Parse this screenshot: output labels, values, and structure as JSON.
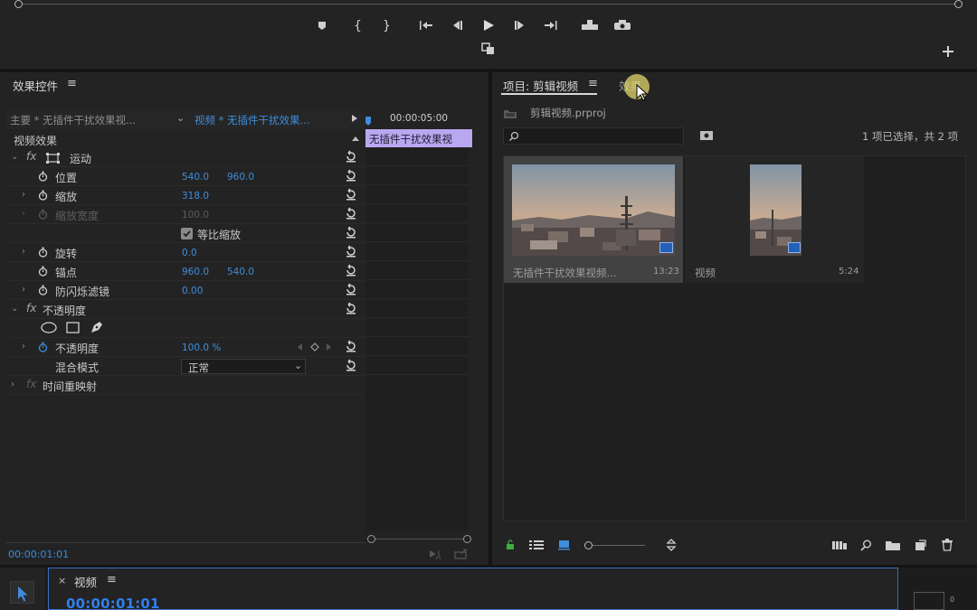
{
  "colors": {
    "accent_blue": "#3f8ddb",
    "timecode_blue": "#2f7ff0",
    "clip_label_purple": "#b9a8f0",
    "panel_bg": "#232323"
  },
  "monitor": {
    "transport_icons": [
      "marker-icon",
      "mark-in-icon",
      "mark-out-icon",
      "go-to-in-icon",
      "step-back-icon",
      "play-icon",
      "step-forward-icon",
      "go-to-out-icon",
      "lift-icon",
      "extract-icon",
      "export-frame-icon",
      "add-button-icon"
    ]
  },
  "effect_controls": {
    "tab_title": "效果控件",
    "menu_glyph": "≡",
    "master_label": "主要 * 无插件干扰效果视...",
    "sequence_label": "视频 * 无插件干扰效果...",
    "timecode_ruler": "00:00:05:00",
    "clip_bar_label": "无插件干扰效果视",
    "section_video": "视频效果",
    "motion": "运动",
    "position": "位置",
    "position_x": "540.0",
    "position_y": "960.0",
    "scale": "缩放",
    "scale_val": "318.0",
    "scale_width": "缩放宽度",
    "scale_width_val": "100.0",
    "uniform_scale": "等比缩放",
    "rotation": "旋转",
    "rotation_val": "0.0",
    "anchor": "锚点",
    "anchor_x": "960.0",
    "anchor_y": "540.0",
    "anti_flicker": "防闪烁滤镜",
    "anti_flicker_val": "0.00",
    "opacity_section": "不透明度",
    "opacity": "不透明度",
    "opacity_val": "100.0 %",
    "blend_mode": "混合模式",
    "blend_mode_val": "正常",
    "time_remap": "时间重映射",
    "current_time": "00:00:01:01"
  },
  "project": {
    "tab_title": "项目: 剪辑视频",
    "menu_glyph": "≡",
    "second_tab": "效果",
    "file_name": "剪辑视频.prproj",
    "search_placeholder": "",
    "selection_status": "1 项已选择，共 2 项",
    "items": [
      {
        "name": "无插件干扰效果视频...",
        "duration": "13:23"
      },
      {
        "name": "视频",
        "duration": "5:24"
      }
    ]
  },
  "timeline": {
    "close": "×",
    "tab_title": "视频",
    "menu_glyph": "≡",
    "timecode": "00:00:01:01",
    "meter_label": "0"
  }
}
